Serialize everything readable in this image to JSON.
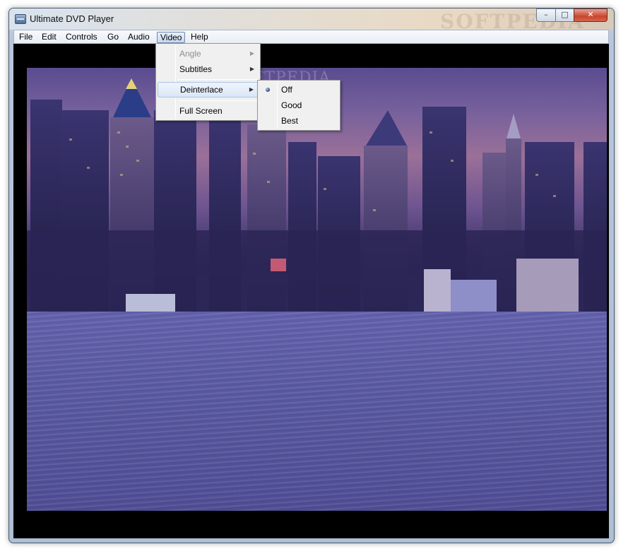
{
  "window": {
    "title": "Ultimate DVD Player",
    "controls": {
      "minimize": "–",
      "maximize": "□",
      "close": "✕"
    }
  },
  "menubar": {
    "items": [
      "File",
      "Edit",
      "Controls",
      "Go",
      "Audio",
      "Video",
      "Help"
    ],
    "active": "Video"
  },
  "video_menu": {
    "items": [
      {
        "label": "Angle",
        "enabled": false,
        "submenu": true
      },
      {
        "label": "Subtitles",
        "enabled": true,
        "submenu": true
      },
      {
        "label": "Deinterlace",
        "enabled": true,
        "submenu": true
      },
      {
        "label": "Full Screen",
        "enabled": true,
        "submenu": false
      }
    ]
  },
  "deinterlace_submenu": {
    "items": [
      "Off",
      "Good",
      "Best"
    ],
    "selected": "Off"
  },
  "watermark": "SOFTPEDIA",
  "icons": {
    "submenu_arrow": "▶",
    "app": "dvd-player-icon"
  }
}
